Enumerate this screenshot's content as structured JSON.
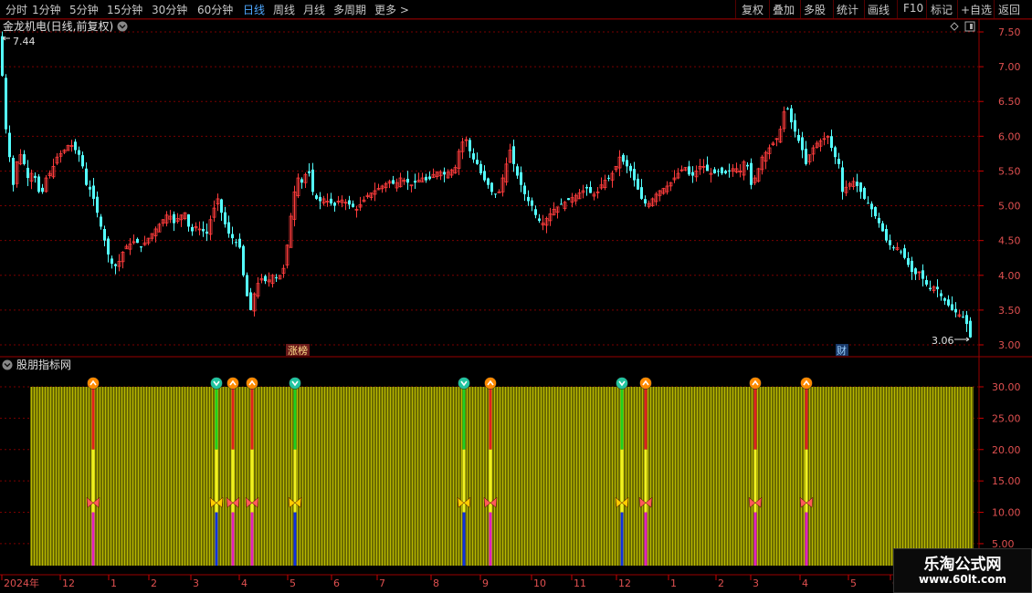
{
  "toolbar": {
    "periods": [
      "分时",
      "1分钟",
      "5分钟",
      "15分钟",
      "30分钟",
      "60分钟",
      "日线",
      "周线",
      "月线",
      "多周期",
      "更多 >"
    ],
    "active_period": "日线",
    "right_buttons": [
      "复权",
      "叠加",
      "多股",
      "统计",
      "画线",
      "F10",
      "标记",
      "+自选",
      "返回"
    ]
  },
  "chart_header": {
    "title": "金龙机电(日线,前复权)",
    "max_label": "7.44",
    "min_label": "3.06"
  },
  "markers": {
    "zhangbang": "涨榜",
    "cai": "财"
  },
  "indicator": {
    "title": "股朋指标网"
  },
  "price_axis": [
    "7.50",
    "7.00",
    "6.50",
    "6.00",
    "5.50",
    "5.00",
    "4.50",
    "4.00",
    "3.50",
    "3.00"
  ],
  "indicator_axis": [
    "30.00",
    "25.00",
    "20.00",
    "15.00",
    "10.00",
    "5.00"
  ],
  "time_axis": [
    "2024年",
    "12",
    "1",
    "2",
    "3",
    "4",
    "5",
    "6",
    "7",
    "8",
    "9",
    "10",
    "11",
    "12",
    "1",
    "2",
    "3",
    "4",
    "5",
    "6"
  ],
  "watermark": {
    "title": "乐淘公式网",
    "url": "www.60lt.com"
  },
  "colors": {
    "up": "#ff3c3c",
    "down": "#54ffff",
    "grid": "#7a0000",
    "bar_fill": "#6b6b00",
    "bar_line": "#b8b800"
  },
  "chart_data": {
    "type": "candlestick",
    "title": "金龙机电(日线,前复权)",
    "price_range": [
      3.0,
      7.5
    ],
    "highest": 7.44,
    "lowest": 3.06,
    "close_path": [
      [
        0,
        7.44
      ],
      [
        4,
        6.3
      ],
      [
        8,
        5.9
      ],
      [
        14,
        5.3
      ],
      [
        20,
        5.8
      ],
      [
        26,
        5.6
      ],
      [
        30,
        5.4
      ],
      [
        36,
        5.5
      ],
      [
        44,
        5.1
      ],
      [
        50,
        5.4
      ],
      [
        56,
        5.5
      ],
      [
        62,
        5.7
      ],
      [
        70,
        5.8
      ],
      [
        76,
        5.9
      ],
      [
        82,
        5.8
      ],
      [
        88,
        5.7
      ],
      [
        94,
        5.3
      ],
      [
        100,
        5.2
      ],
      [
        106,
        4.9
      ],
      [
        112,
        4.6
      ],
      [
        118,
        4.3
      ],
      [
        124,
        4.1
      ],
      [
        130,
        4.2
      ],
      [
        136,
        4.4
      ],
      [
        142,
        4.45
      ],
      [
        148,
        4.5
      ],
      [
        154,
        4.4
      ],
      [
        160,
        4.5
      ],
      [
        166,
        4.6
      ],
      [
        172,
        4.7
      ],
      [
        178,
        4.8
      ],
      [
        184,
        4.9
      ],
      [
        190,
        4.75
      ],
      [
        196,
        4.85
      ],
      [
        202,
        4.9
      ],
      [
        208,
        4.6
      ],
      [
        214,
        4.7
      ],
      [
        220,
        4.65
      ],
      [
        226,
        4.6
      ],
      [
        232,
        4.9
      ],
      [
        238,
        5.1
      ],
      [
        244,
        4.8
      ],
      [
        250,
        4.6
      ],
      [
        256,
        4.5
      ],
      [
        262,
        4.4
      ],
      [
        268,
        3.8
      ],
      [
        274,
        3.5
      ],
      [
        280,
        3.85
      ],
      [
        286,
        3.95
      ],
      [
        292,
        3.9
      ],
      [
        298,
        4.0
      ],
      [
        304,
        3.95
      ],
      [
        310,
        4.1
      ],
      [
        316,
        4.6
      ],
      [
        320,
        5.1
      ],
      [
        326,
        5.4
      ],
      [
        332,
        5.3
      ],
      [
        336,
        5.6
      ],
      [
        342,
        5.2
      ],
      [
        348,
        5.05
      ],
      [
        354,
        5.1
      ],
      [
        360,
        5.05
      ],
      [
        366,
        5.0
      ],
      [
        372,
        5.1
      ],
      [
        378,
        5.05
      ],
      [
        384,
        5.0
      ],
      [
        390,
        4.95
      ],
      [
        396,
        5.05
      ],
      [
        402,
        5.15
      ],
      [
        408,
        5.2
      ],
      [
        414,
        5.25
      ],
      [
        420,
        5.3
      ],
      [
        426,
        5.35
      ],
      [
        432,
        5.3
      ],
      [
        438,
        5.4
      ],
      [
        444,
        5.35
      ],
      [
        450,
        5.3
      ],
      [
        456,
        5.35
      ],
      [
        462,
        5.4
      ],
      [
        468,
        5.35
      ],
      [
        474,
        5.45
      ],
      [
        480,
        5.5
      ],
      [
        486,
        5.45
      ],
      [
        492,
        5.5
      ],
      [
        498,
        5.55
      ],
      [
        504,
        5.9
      ],
      [
        510,
        5.95
      ],
      [
        516,
        5.7
      ],
      [
        522,
        5.6
      ],
      [
        528,
        5.4
      ],
      [
        534,
        5.3
      ],
      [
        540,
        5.15
      ],
      [
        546,
        5.2
      ],
      [
        552,
        5.5
      ],
      [
        558,
        5.8
      ],
      [
        564,
        5.5
      ],
      [
        570,
        5.3
      ],
      [
        576,
        5.1
      ],
      [
        582,
        5.0
      ],
      [
        588,
        4.8
      ],
      [
        594,
        4.75
      ],
      [
        600,
        4.85
      ],
      [
        606,
        4.95
      ],
      [
        612,
        5.0
      ],
      [
        618,
        5.05
      ],
      [
        624,
        5.1
      ],
      [
        630,
        5.15
      ],
      [
        636,
        5.2
      ],
      [
        642,
        5.25
      ],
      [
        648,
        5.15
      ],
      [
        654,
        5.2
      ],
      [
        660,
        5.35
      ],
      [
        666,
        5.4
      ],
      [
        672,
        5.5
      ],
      [
        678,
        5.7
      ],
      [
        684,
        5.6
      ],
      [
        690,
        5.5
      ],
      [
        696,
        5.3
      ],
      [
        702,
        5.1
      ],
      [
        708,
        5.0
      ],
      [
        714,
        5.1
      ],
      [
        720,
        5.2
      ],
      [
        726,
        5.25
      ],
      [
        732,
        5.3
      ],
      [
        738,
        5.4
      ],
      [
        744,
        5.5
      ],
      [
        750,
        5.55
      ],
      [
        756,
        5.4
      ],
      [
        762,
        5.5
      ],
      [
        768,
        5.6
      ],
      [
        774,
        5.5
      ],
      [
        780,
        5.45
      ],
      [
        786,
        5.5
      ],
      [
        792,
        5.45
      ],
      [
        798,
        5.5
      ],
      [
        804,
        5.55
      ],
      [
        810,
        5.5
      ],
      [
        816,
        5.7
      ],
      [
        822,
        5.3
      ],
      [
        828,
        5.45
      ],
      [
        834,
        5.7
      ],
      [
        840,
        5.8
      ],
      [
        846,
        5.9
      ],
      [
        852,
        6.0
      ],
      [
        856,
        6.2
      ],
      [
        860,
        6.5
      ],
      [
        866,
        6.2
      ],
      [
        872,
        6.0
      ],
      [
        878,
        5.8
      ],
      [
        882,
        5.6
      ],
      [
        888,
        5.8
      ],
      [
        894,
        5.9
      ],
      [
        900,
        5.95
      ],
      [
        906,
        6.0
      ],
      [
        912,
        5.75
      ],
      [
        918,
        5.6
      ],
      [
        922,
        5.2
      ],
      [
        928,
        5.3
      ],
      [
        934,
        5.35
      ],
      [
        940,
        5.25
      ],
      [
        946,
        5.1
      ],
      [
        952,
        5.0
      ],
      [
        958,
        4.85
      ],
      [
        964,
        4.7
      ],
      [
        970,
        4.5
      ],
      [
        976,
        4.4
      ],
      [
        982,
        4.4
      ],
      [
        988,
        4.3
      ],
      [
        994,
        4.15
      ],
      [
        1000,
        4.0
      ],
      [
        1006,
        4.05
      ],
      [
        1012,
        3.9
      ],
      [
        1018,
        3.8
      ],
      [
        1024,
        3.85
      ],
      [
        1030,
        3.7
      ],
      [
        1036,
        3.6
      ],
      [
        1042,
        3.5
      ],
      [
        1048,
        3.45
      ],
      [
        1054,
        3.4
      ],
      [
        1058,
        3.3
      ],
      [
        1063,
        3.06
      ]
    ],
    "indicator": {
      "title": "股朋指标网",
      "range": [
        0,
        30
      ],
      "bar_level": 30,
      "signals": [
        {
          "dir": "up",
          "i": 0
        },
        {
          "dir": "down",
          "i": 1
        },
        {
          "dir": "up",
          "i": 2
        },
        {
          "dir": "up",
          "i": 3
        },
        {
          "dir": "down",
          "i": 4
        },
        {
          "dir": "down",
          "i": 5
        },
        {
          "dir": "up",
          "i": 6
        },
        {
          "dir": "down",
          "i": 7
        },
        {
          "dir": "up",
          "i": 8
        },
        {
          "dir": "up",
          "i": 9
        },
        {
          "dir": "up",
          "i": 10
        }
      ]
    }
  }
}
